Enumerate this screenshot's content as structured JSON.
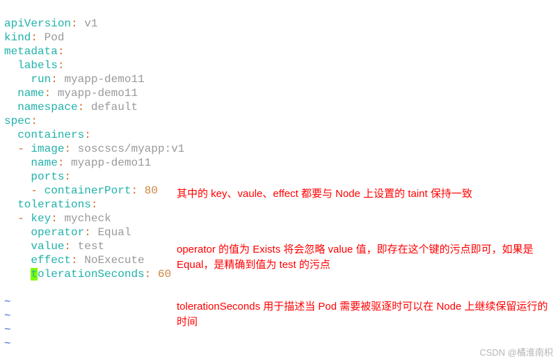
{
  "yaml": {
    "l1_key": "apiVersion",
    "l1_val": "v1",
    "l2_key": "kind",
    "l2_val": "Pod",
    "l3_key": "metadata",
    "l4_key": "labels",
    "l5_key": "run",
    "l5_val": "myapp-demo11",
    "l6_key": "name",
    "l6_val": "myapp-demo11",
    "l7_key": "namespace",
    "l7_val": "default",
    "l8_key": "spec",
    "l9_key": "containers",
    "l10_key": "image",
    "l10_val": "soscscs/myapp:v1",
    "l11_key": "name",
    "l11_val": "myapp-demo11",
    "l12_key": "ports",
    "l13_key": "containerPort",
    "l13_val": "80",
    "l14_key": "tolerations",
    "l15_key": "key",
    "l15_val": "mycheck",
    "l16_key": "operator",
    "l16_val": "Equal",
    "l17_key": "value",
    "l17_val": "test",
    "l18_key": "effect",
    "l18_val": "NoExecute",
    "l19_cursor": "t",
    "l19_key_rest": "olerationSeconds",
    "l19_val": "60",
    "tilde": "~"
  },
  "annotations": {
    "a1": "其中的 key、vaule、effect 都要与 Node 上设置的 taint 保持一致",
    "a2": "operator 的值为 Exists 将会忽略 value 值，即存在这个键的污点即可，如果是Equal，是精确到值为 test 的污点",
    "a3": "tolerationSeconds 用于描述当 Pod 需要被驱逐时可以在 Node 上继续保留运行的时间"
  },
  "watermark": "CSDN @橘淮南枳"
}
